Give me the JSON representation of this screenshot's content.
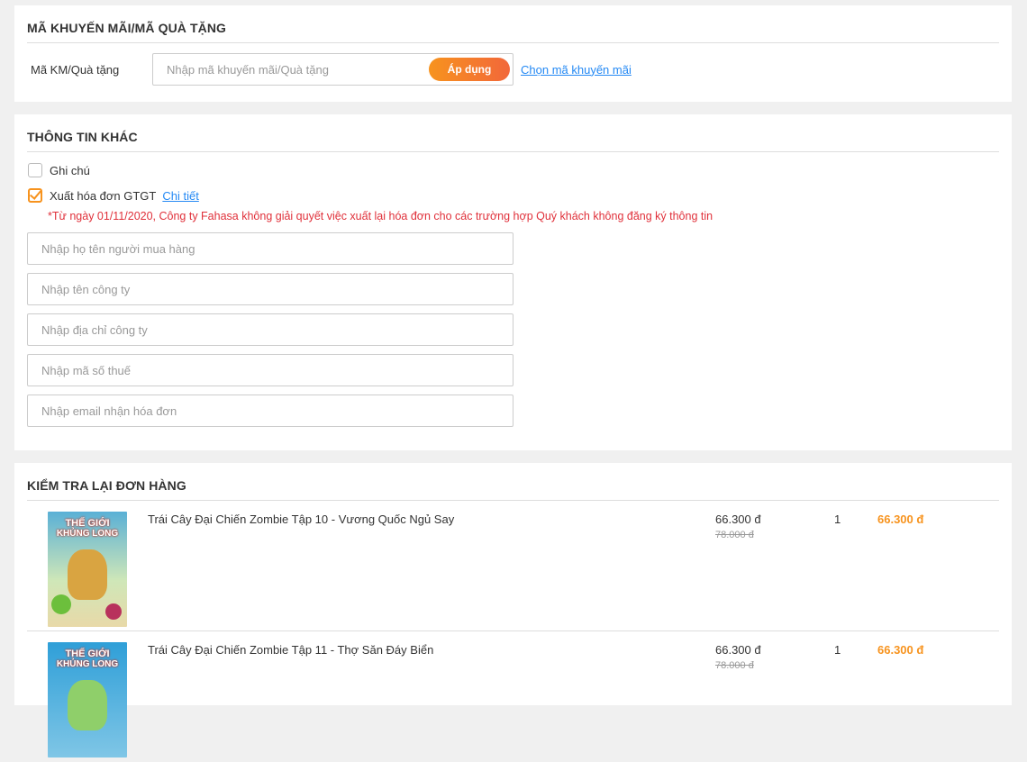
{
  "promo": {
    "title": "MÃ KHUYẾN MÃI/MÃ QUÀ TẶNG",
    "label": "Mã KM/Quà tặng",
    "placeholder": "Nhập mã khuyến mãi/Quà tặng",
    "apply_label": "Áp dụng",
    "choose_link": "Chọn mã khuyến mãi",
    "apply_color": "#f7931e"
  },
  "other": {
    "title": "THÔNG TIN KHÁC",
    "note_label": "Ghi chú",
    "note_checked": false,
    "invoice_label": "Xuất hóa đơn GTGT",
    "invoice_checked": true,
    "detail_link": "Chi tiết",
    "notice": "*Từ ngày 01/11/2020, Công ty Fahasa không giải quyết việc xuất lại hóa đơn cho các trường hợp Quý khách không đăng ký thông tin",
    "fields": [
      {
        "placeholder": "Nhập họ tên người mua hàng",
        "value": ""
      },
      {
        "placeholder": "Nhập tên công ty",
        "value": ""
      },
      {
        "placeholder": "Nhập địa chỉ công ty",
        "value": ""
      },
      {
        "placeholder": "Nhập mã số thuế",
        "value": ""
      },
      {
        "placeholder": "Nhập email nhận hóa đơn",
        "value": ""
      }
    ]
  },
  "review": {
    "title": "KIỂM TRA LẠI ĐƠN HÀNG",
    "items": [
      {
        "name": "Trái Cây Đại Chiến Zombie Tập 10 - Vương Quốc Ngủ Say",
        "price": "66.300 đ",
        "old_price": "78.000 đ",
        "qty": "1",
        "total": "66.300 đ",
        "cover_line1": "THẾ GIỚI",
        "cover_line2": "KHỦNG LONG"
      },
      {
        "name": "Trái Cây Đại Chiến Zombie Tập 11 - Thợ Săn Đáy Biển",
        "price": "66.300 đ",
        "old_price": "78.000 đ",
        "qty": "1",
        "total": "66.300 đ",
        "cover_line1": "THẾ GIỚI",
        "cover_line2": "KHỦNG LONG"
      }
    ]
  },
  "colors": {
    "accent": "#f7931e",
    "link": "#2489f4",
    "warning": "#e0303a",
    "cover_1_bg": "#5ab0d6",
    "cover_2_bg": "#2f9fd8"
  }
}
